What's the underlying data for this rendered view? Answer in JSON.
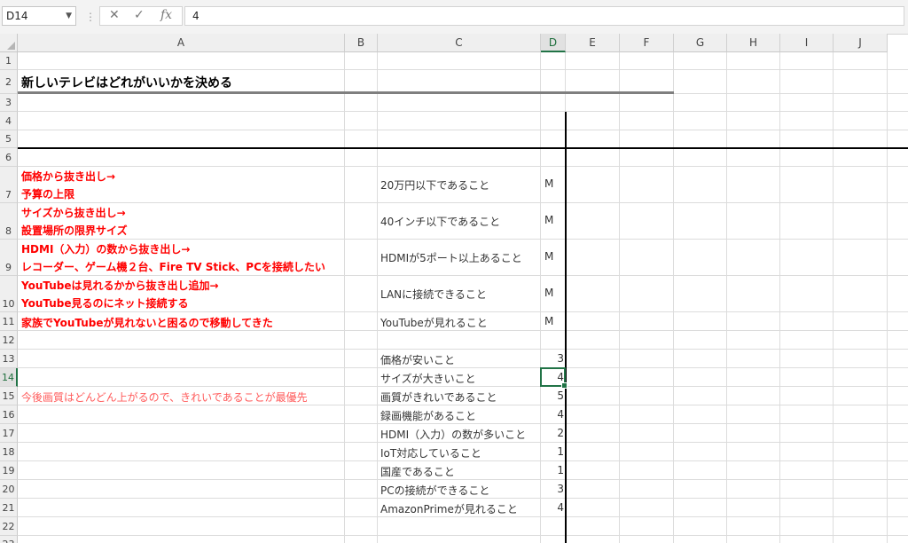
{
  "formula_bar": {
    "name_box": "D14",
    "formula_value": "4",
    "cancel_icon": "x-icon",
    "enter_icon": "check-icon",
    "function_icon": "fx-icon"
  },
  "columns": [
    "A",
    "B",
    "C",
    "D",
    "E",
    "F",
    "G",
    "H",
    "I",
    "J"
  ],
  "rows": [
    "1",
    "2",
    "3",
    "4",
    "5",
    "6",
    "7",
    "8",
    "9",
    "10",
    "11",
    "12",
    "13",
    "14",
    "15",
    "16",
    "17",
    "18",
    "19",
    "20",
    "21",
    "22",
    "23"
  ],
  "selected_cell": "D14",
  "title": "新しいテレビはどれがいいかを決める",
  "notes": {
    "r7a": "価格から抜き出し→",
    "r7b": "予算の上限",
    "r8a": "サイズから抜き出し→",
    "r8b": "設置場所の限界サイズ",
    "r9a": "HDMI（入力）の数から抜き出し→",
    "r9b": "レコーダー、ゲーム機２台、Fire TV Stick、PCを接続したい",
    "r10a": "YouTubeは見れるかから抜き出し追加→",
    "r10b": "YouTube見るのにネット接続する",
    "r11": "家族でYouTubeが見れないと困るので移動してきた",
    "r15": "今後画質はどんどん上がるので、きれいであることが最優先"
  },
  "must_items": [
    {
      "item": "20万円以下であること",
      "flag": "M"
    },
    {
      "item": "40インチ以下であること",
      "flag": "M"
    },
    {
      "item": "HDMIが5ポート以上あること",
      "flag": "M"
    },
    {
      "item": "LANに接続できること",
      "flag": "M"
    },
    {
      "item": "YouTubeが見れること",
      "flag": "M"
    }
  ],
  "want_items": [
    {
      "item": "価格が安いこと",
      "score": "3"
    },
    {
      "item": "サイズが大きいこと",
      "score": "4"
    },
    {
      "item": "画質がきれいであること",
      "score": "5"
    },
    {
      "item": "録画機能があること",
      "score": "4"
    },
    {
      "item": "HDMI（入力）の数が多いこと",
      "score": "2"
    },
    {
      "item": "IoT対応していること",
      "score": "1"
    },
    {
      "item": "国産であること",
      "score": "1"
    },
    {
      "item": "PCの接続ができること",
      "score": "3"
    },
    {
      "item": "AmazonPrimeが見れること",
      "score": "4"
    }
  ]
}
